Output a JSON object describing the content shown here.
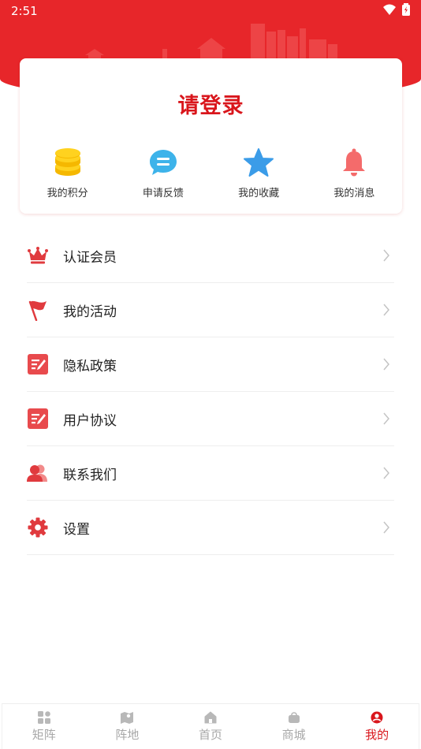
{
  "status_bar": {
    "time": "2:51"
  },
  "login_card": {
    "title": "请登录",
    "quick_actions": [
      {
        "label": "我的积分",
        "icon": "coins-icon"
      },
      {
        "label": "申请反馈",
        "icon": "chat-bubble-icon"
      },
      {
        "label": "我的收藏",
        "icon": "star-icon"
      },
      {
        "label": "我的消息",
        "icon": "bell-icon"
      }
    ]
  },
  "menu": [
    {
      "label": "认证会员",
      "icon": "crown-icon"
    },
    {
      "label": "我的活动",
      "icon": "flag-icon"
    },
    {
      "label": "隐私政策",
      "icon": "document-edit-icon"
    },
    {
      "label": "用户协议",
      "icon": "document-edit-icon"
    },
    {
      "label": "联系我们",
      "icon": "contacts-icon"
    },
    {
      "label": "设置",
      "icon": "gear-icon"
    }
  ],
  "bottom_nav": {
    "items": [
      {
        "label": "矩阵",
        "icon": "grid-icon"
      },
      {
        "label": "阵地",
        "icon": "map-icon"
      },
      {
        "label": "首页",
        "icon": "home-icon"
      },
      {
        "label": "商城",
        "icon": "bag-icon"
      },
      {
        "label": "我的",
        "icon": "user-icon"
      }
    ],
    "active_index": 4
  },
  "colors": {
    "brand_red": "#e7262a",
    "active_red": "#d9161c",
    "inactive_gray": "#a8a8a8"
  }
}
